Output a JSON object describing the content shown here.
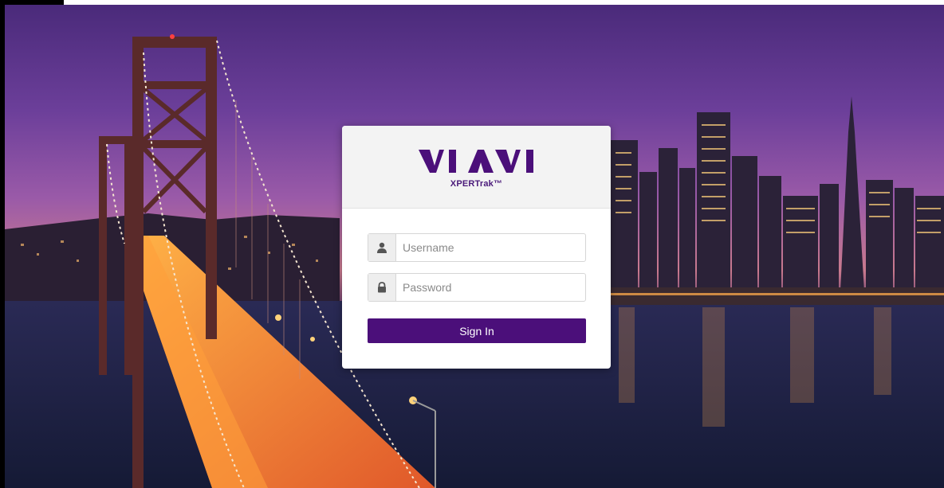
{
  "brand": {
    "logo_text": "VIAVI",
    "product": "XPERTrak™"
  },
  "login": {
    "username_placeholder": "Username",
    "password_placeholder": "Password",
    "signin_label": "Sign In"
  },
  "icons": {
    "user": "user-icon",
    "lock": "lock-icon"
  },
  "colors": {
    "brand_purple": "#4b0f7a"
  }
}
